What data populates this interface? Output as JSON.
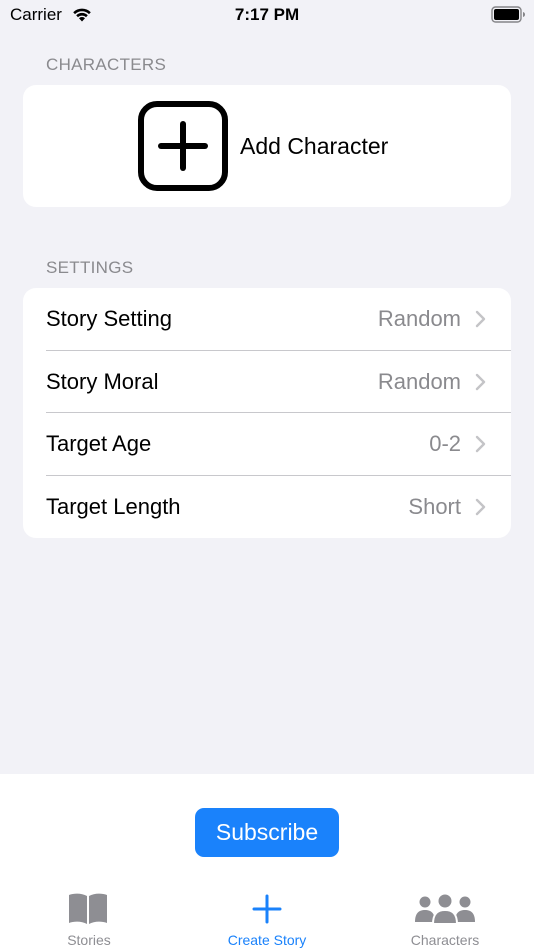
{
  "status_bar": {
    "carrier": "Carrier",
    "time": "7:17 PM"
  },
  "characters_section": {
    "header": "CHARACTERS",
    "add_label": "Add Character"
  },
  "settings_section": {
    "header": "SETTINGS",
    "rows": [
      {
        "label": "Story Setting",
        "value": "Random"
      },
      {
        "label": "Story Moral",
        "value": "Random"
      },
      {
        "label": "Target Age",
        "value": "0-2"
      },
      {
        "label": "Target Length",
        "value": "Short"
      }
    ]
  },
  "subscribe": {
    "label": "Subscribe"
  },
  "tab_bar": {
    "tabs": [
      {
        "label": "Stories",
        "icon": "book-icon",
        "active": false
      },
      {
        "label": "Create Story",
        "icon": "plus-icon",
        "active": true
      },
      {
        "label": "Characters",
        "icon": "people-icon",
        "active": false
      }
    ]
  },
  "colors": {
    "accent": "#1A82FB",
    "background": "#F2F2F7",
    "secondary_text": "#8A8A8E"
  }
}
